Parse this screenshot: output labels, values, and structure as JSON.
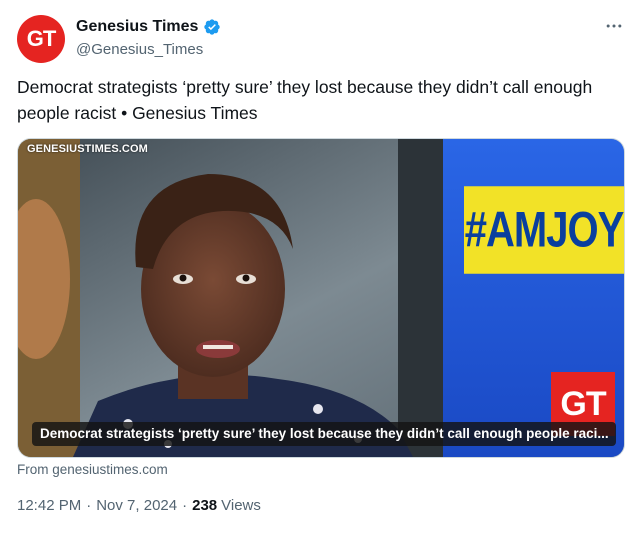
{
  "account": {
    "avatar_text": "GT",
    "display_name": "Genesius Times",
    "handle": "@Genesius_Times",
    "verified": true,
    "avatar_color": "#e52421",
    "verified_color": "#1d9bf0"
  },
  "more_icon": "more-horizontal-icon",
  "tweet": {
    "text": "Democrat strategists ‘pretty sure’ they lost because they didn’t call enough people racist • Genesius Times"
  },
  "media": {
    "watermark": "GENESIUSTIMES.COM",
    "show_tag": "#AMJOY",
    "logo_text": "GT",
    "caption": "Democrat strategists ‘pretty sure’ they lost because they didn’t call enough people raci...",
    "tag_color": "#f2e227",
    "tag_text_color": "#0a3f9e",
    "background_blue": "#1f56d6"
  },
  "source": "From genesiustimes.com",
  "meta": {
    "time": "12:42 PM",
    "separator": "·",
    "date": "Nov 7, 2024",
    "views_count": "238",
    "views_label": "Views"
  }
}
